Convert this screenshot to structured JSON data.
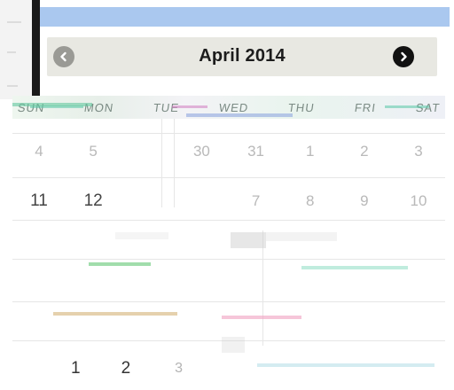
{
  "calendar": {
    "month_title": "April 2014",
    "weekdays": [
      "SUN",
      "MON",
      "TUE",
      "WED",
      "THU",
      "FRI",
      "SAT"
    ],
    "weeks": [
      [
        "4",
        "5",
        "",
        "30",
        "31",
        "1",
        "2",
        "3"
      ],
      [
        "11",
        "12",
        "",
        "",
        "7",
        "8",
        "9",
        "10"
      ],
      [
        "",
        "",
        "",
        "",
        "",
        "",
        "",
        ""
      ],
      [
        "",
        "",
        "",
        "",
        "",
        "",
        "",
        ""
      ]
    ]
  },
  "pager": {
    "pages": [
      "1",
      "2",
      "3"
    ],
    "trailing": ""
  },
  "icons": {
    "prev": "chevron-left-icon",
    "next": "chevron-right-icon"
  },
  "colors": {
    "header_bg": "#e8e8e2",
    "top_band": "#aac8ef",
    "dark_bar": "#1a1a1a",
    "next_btn": "#111111",
    "prev_btn": "#9a9a95"
  }
}
